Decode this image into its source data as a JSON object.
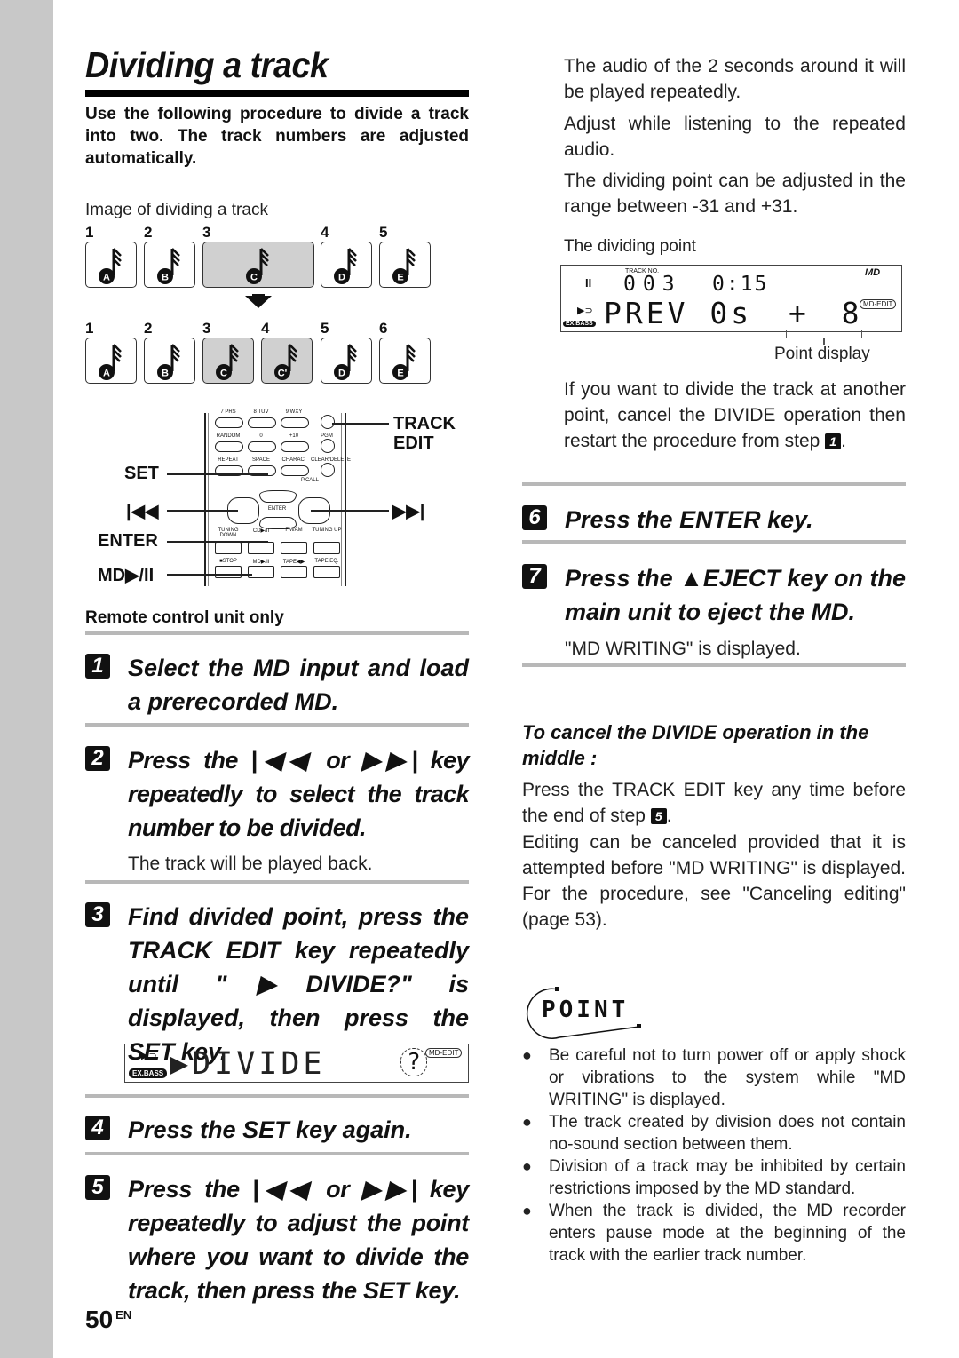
{
  "page": {
    "title": "Dividing a track",
    "intro": "Use the following procedure to divide a track into two. The track numbers are adjusted automatically.",
    "page_number": "50",
    "page_lang": "EN",
    "accent_color": "#000000",
    "sidebar_color": "#c8c8c8"
  },
  "diagram": {
    "caption": "Image of dividing a track",
    "before": [
      {
        "num": "1",
        "letter": "A",
        "highlight": false
      },
      {
        "num": "2",
        "letter": "B",
        "highlight": false
      },
      {
        "num": "3",
        "letter": "C",
        "highlight": true
      },
      {
        "num": "4",
        "letter": "D",
        "highlight": false
      },
      {
        "num": "5",
        "letter": "E",
        "highlight": false
      }
    ],
    "after": [
      {
        "num": "1",
        "letter": "A",
        "highlight": false
      },
      {
        "num": "2",
        "letter": "B",
        "highlight": false
      },
      {
        "num": "3",
        "letter": "C",
        "highlight": true
      },
      {
        "num": "4",
        "letter": "C'",
        "highlight": true
      },
      {
        "num": "5",
        "letter": "D",
        "highlight": false
      },
      {
        "num": "6",
        "letter": "E",
        "highlight": false
      }
    ]
  },
  "remote": {
    "labels": {
      "track_edit_1": "TRACK",
      "track_edit_2": "EDIT",
      "set": "SET",
      "prev": "|◀◀",
      "next": "▶▶|",
      "enter": "ENTER",
      "md_play": "MD▶/II"
    },
    "buttons": {
      "row1": [
        "7 PRS",
        "8 TUV",
        "9 WXY",
        ""
      ],
      "row2": [
        "RANDOM",
        "0",
        "+10",
        "PGM"
      ],
      "row3": [
        "REPEAT",
        "SPACE",
        "CHARAC.",
        "CLEAR/DELETE"
      ],
      "pcall": "P.CALL",
      "set": "SET",
      "enter": "ENTER",
      "row4_labels": [
        "TUNING DOWN",
        "CD▶/II",
        "FM/AM",
        "TUNING UP"
      ],
      "row5_labels": [
        "■STOP",
        "MD▶/II",
        "TAPE◀▶",
        "TAPE EQ."
      ]
    },
    "caption": "Remote control unit only"
  },
  "steps_left": [
    {
      "num": "1",
      "text": "Select the MD input and load a prerecorded MD."
    },
    {
      "num": "2",
      "text": "Press the |◀◀ or ▶▶| key repeatedly to select the track number to be divided.",
      "note": "The track will be played back."
    },
    {
      "num": "3",
      "text": "Find divided point, press the TRACK EDIT key repeatedly until \"▶DIVIDE?\" is displayed, then press the SET key."
    },
    {
      "num": "4",
      "text": "Press the SET key again."
    },
    {
      "num": "5",
      "text": "Press the |◀◀ or ▶▶| key repeatedly to adjust the point where you want to divide the track, then press the SET key."
    }
  ],
  "divide_display": {
    "text": "▶DIVIDE",
    "question": "?",
    "exbass": "EX.BASS",
    "mdedit": "MD-EDIT"
  },
  "right": {
    "p1": "The audio of the 2 seconds around it will be played repeatedly.",
    "p2": "Adjust while listening to the repeated audio.",
    "p3": "The dividing point can be adjusted in the range between -31 and +31.",
    "dividing_point_caption": "The dividing point",
    "lcd": {
      "track_no_label": "TRACK NO.",
      "track_no": "003",
      "time": "0:15",
      "md": "MD",
      "main": "PREV 0s",
      "point": "+  8",
      "exbass": "EX.BASS",
      "mdedit": "MD-EDIT",
      "pause": "II"
    },
    "point_display_label": "Point display",
    "p4": "If you want to divide the track at another point, cancel the DIVIDE operation then restart the procedure from step",
    "p4_step": "1",
    "steps": [
      {
        "num": "6",
        "text": "Press the ENTER key."
      },
      {
        "num": "7",
        "text": "Press the ▲EJECT key on the main unit to eject the MD.",
        "note": "\"MD WRITING\" is displayed."
      }
    ],
    "cancel_heading": "To cancel the DIVIDE operation in the middle :",
    "cancel_p1": "Press the TRACK EDIT key any time before the end of step",
    "cancel_p1_step": "5",
    "cancel_p2": "Editing can be canceled provided that it is attempted before \"MD WRITING\" is displayed. For the procedure, see \"Canceling editing\" (page 53).",
    "point_logo": "POINT",
    "bullets": [
      "Be careful not to turn power off or apply shock or vibrations to the system while \"MD WRITING\" is displayed.",
      "The track created by division does not contain no-sound section between them.",
      "Division of a track may be inhibited by certain restrictions imposed by the MD standard.",
      "When the track is divided, the MD recorder enters pause mode at the beginning of the track with the earlier track number."
    ]
  }
}
